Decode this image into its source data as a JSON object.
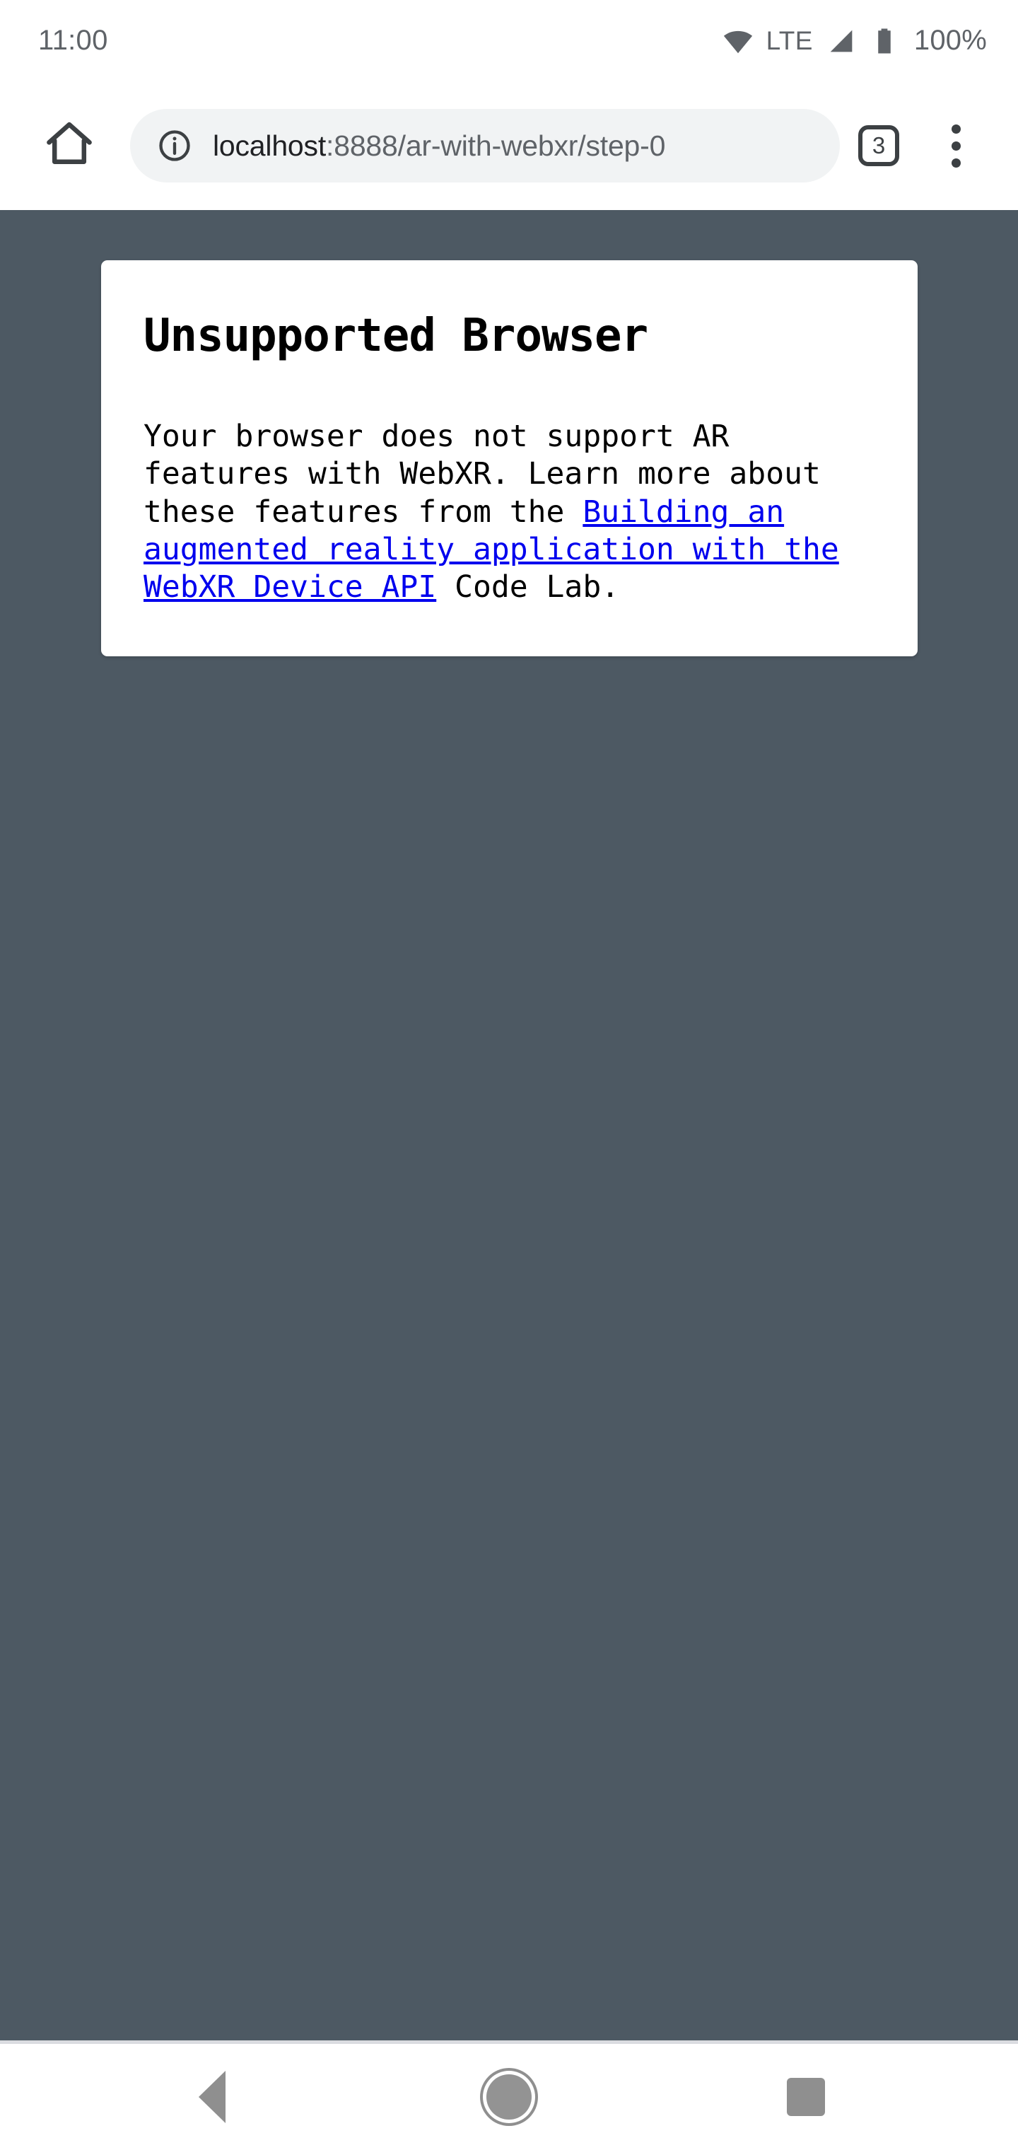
{
  "status_bar": {
    "time": "11:00",
    "network_label": "LTE",
    "battery_percent": "100%",
    "icons": [
      "wifi-icon",
      "signal-icon",
      "battery-icon"
    ]
  },
  "browser": {
    "home_button": "home-icon",
    "omnibox": {
      "security_icon": "info-icon",
      "url_host": "localhost",
      "url_path": ":8888/ar-with-webxr/step-0",
      "url_full": "localhost:8888/ar-with-webxr/step-0"
    },
    "tab_count": "3",
    "menu_button": "overflow-menu-icon"
  },
  "page": {
    "background_color": "#4d5963",
    "card": {
      "background_color": "#ffffff",
      "heading": "Unsupported Browser",
      "body_prefix": "Your browser does not support AR features with WebXR. Learn more about these features from the ",
      "link_text": "Building an augmented reality application with the WebXR Device API",
      "link_color": "#0000ee",
      "body_suffix": " Code Lab."
    }
  },
  "nav_bar": {
    "back_label": "Back",
    "home_label": "Home",
    "recents_label": "Recents"
  }
}
